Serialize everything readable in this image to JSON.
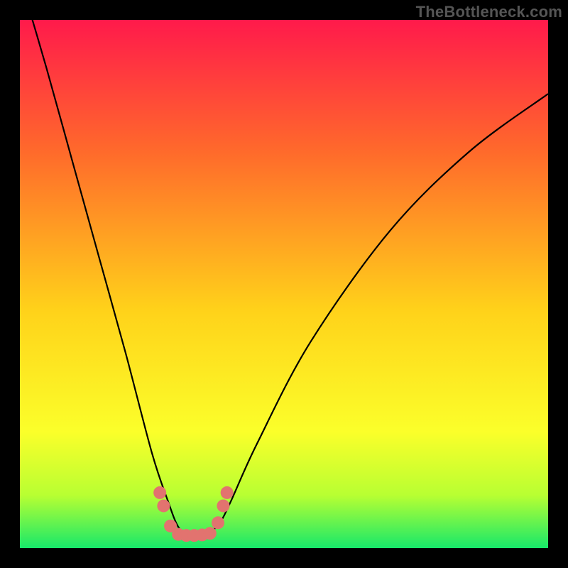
{
  "watermark": "TheBottleneck.com",
  "chart_data": {
    "type": "line",
    "title": "",
    "xlabel": "",
    "ylabel": "",
    "xlim": [
      0,
      100
    ],
    "ylim": [
      0,
      100
    ],
    "gradient_stops": [
      {
        "offset": 0,
        "color": "#ff1a4b"
      },
      {
        "offset": 25,
        "color": "#ff6a2b"
      },
      {
        "offset": 55,
        "color": "#ffd21a"
      },
      {
        "offset": 78,
        "color": "#fbff2a"
      },
      {
        "offset": 90,
        "color": "#b8ff32"
      },
      {
        "offset": 100,
        "color": "#17e86a"
      }
    ],
    "series": [
      {
        "name": "bottleneck-curve",
        "x": [
          0,
          5,
          10,
          15,
          20,
          25,
          28,
          30,
          32,
          34,
          36,
          38,
          40,
          45,
          55,
          70,
          85,
          100
        ],
        "y": [
          108,
          91,
          73,
          55,
          37,
          18,
          9,
          4,
          2.5,
          2.5,
          3,
          5,
          9,
          20,
          39,
          60,
          75,
          86
        ]
      }
    ],
    "markers": {
      "name": "fit-range-markers",
      "color": "#e2736f",
      "points": [
        {
          "x": 26.5,
          "y": 10.5
        },
        {
          "x": 27.2,
          "y": 8.0
        },
        {
          "x": 28.5,
          "y": 4.2
        },
        {
          "x": 30.0,
          "y": 2.6
        },
        {
          "x": 31.5,
          "y": 2.4
        },
        {
          "x": 33.0,
          "y": 2.4
        },
        {
          "x": 34.5,
          "y": 2.5
        },
        {
          "x": 36.0,
          "y": 2.8
        },
        {
          "x": 37.5,
          "y": 4.8
        },
        {
          "x": 38.5,
          "y": 8.0
        },
        {
          "x": 39.2,
          "y": 10.5
        }
      ]
    }
  }
}
